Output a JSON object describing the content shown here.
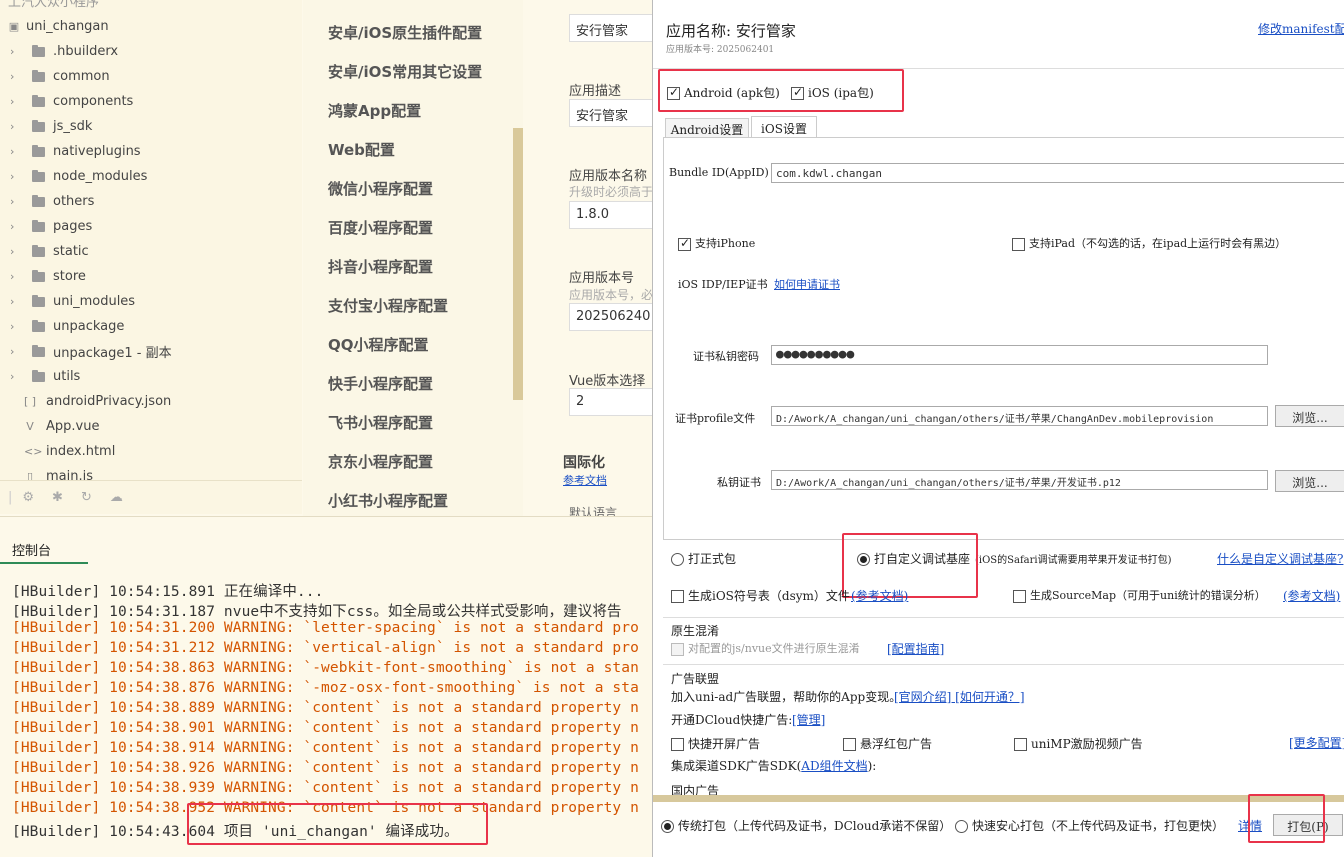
{
  "tree": {
    "header": "上汽大众小程序",
    "project": "uni_changan",
    "items": [
      {
        "label": ".hbuilderx",
        "kind": "folder"
      },
      {
        "label": "common",
        "kind": "folder"
      },
      {
        "label": "components",
        "kind": "folder"
      },
      {
        "label": "js_sdk",
        "kind": "folder"
      },
      {
        "label": "nativeplugins",
        "kind": "folder"
      },
      {
        "label": "node_modules",
        "kind": "folder"
      },
      {
        "label": "others",
        "kind": "folder"
      },
      {
        "label": "pages",
        "kind": "folder"
      },
      {
        "label": "static",
        "kind": "folder"
      },
      {
        "label": "store",
        "kind": "folder"
      },
      {
        "label": "uni_modules",
        "kind": "folder"
      },
      {
        "label": "unpackage",
        "kind": "folder"
      },
      {
        "label": "unpackage1 - 副本",
        "kind": "folder"
      },
      {
        "label": "utils",
        "kind": "folder"
      },
      {
        "label": "androidPrivacy.json",
        "kind": "json"
      },
      {
        "label": "App.vue",
        "kind": "vue"
      },
      {
        "label": "index.html",
        "kind": "html"
      },
      {
        "label": "main.js",
        "kind": "js"
      }
    ]
  },
  "midnav": {
    "items": [
      "安卓/iOS原生插件配置",
      "安卓/iOS常用其它设置",
      "鸿蒙App配置",
      "Web配置",
      "微信小程序配置",
      "百度小程序配置",
      "抖音小程序配置",
      "支付宝小程序配置",
      "QQ小程序配置",
      "快手小程序配置",
      "飞书小程序配置",
      "京东小程序配置",
      "小红书小程序配置"
    ]
  },
  "form": {
    "app_name_value": "安行管家",
    "desc_label": "应用描述",
    "desc_value": "安行管家",
    "vname_label": "应用版本名称",
    "vname_hint": "升级时必须高于",
    "vname_value": "1.8.0",
    "vcode_label": "应用版本号",
    "vcode_hint": "应用版本号，必",
    "vcode_value": "202506240",
    "vue_label": "Vue版本选择",
    "vue_value": "2",
    "i18n_title": "国际化",
    "i18n_link": "参考文档",
    "default_lang": "默认语言"
  },
  "console": {
    "tab": "控制台",
    "lines": [
      {
        "text": "[HBuilder] 10:54:15.891 正在编译中...",
        "level": "normal"
      },
      {
        "text": "[HBuilder] 10:54:31.187 nvue中不支持如下css。如全局或公共样式受影响，建议将告",
        "level": "normal"
      },
      {
        "text": "[HBuilder] 10:54:31.200 WARNING: `letter-spacing` is not a standard pro",
        "level": "warn"
      },
      {
        "text": "[HBuilder] 10:54:31.212 WARNING: `vertical-align` is not a standard pro",
        "level": "warn"
      },
      {
        "text": "[HBuilder] 10:54:38.863 WARNING: `-webkit-font-smoothing` is not a stan",
        "level": "warn"
      },
      {
        "text": "[HBuilder] 10:54:38.876 WARNING: `-moz-osx-font-smoothing` is not a sta",
        "level": "warn"
      },
      {
        "text": "[HBuilder] 10:54:38.889 WARNING: `content` is not a standard property n",
        "level": "warn"
      },
      {
        "text": "[HBuilder] 10:54:38.901 WARNING: `content` is not a standard property n",
        "level": "warn"
      },
      {
        "text": "[HBuilder] 10:54:38.914 WARNING: `content` is not a standard property n",
        "level": "warn"
      },
      {
        "text": "[HBuilder] 10:54:38.926 WARNING: `content` is not a standard property n",
        "level": "warn"
      },
      {
        "text": "[HBuilder] 10:54:38.939 WARNING: `content` is not a standard property n",
        "level": "warn"
      },
      {
        "text": "[HBuilder] 10:54:38.952 WARNING: `content` is not a standard property n",
        "level": "warn"
      },
      {
        "text": "[HBuilder] 10:54:43.604 项目 'uni_changan' 编译成功。",
        "level": "normal"
      }
    ]
  },
  "dialog": {
    "app_name": "应用名称: 安行管家",
    "version_hint": "应用版本号: 2025062401",
    "edit_manifest": "修改manifest配置",
    "android_pkg": "Android (apk包)",
    "ios_pkg": "iOS (ipa包)",
    "tab_android": "Android设置",
    "tab_ios": "iOS设置",
    "bundle_label": "Bundle ID(AppID)",
    "bundle_value": "com.kdwl.changan",
    "support_iphone": "支持iPhone",
    "support_ipad": "支持iPad（不勾选的话，在ipad上运行时会有黑边）",
    "cert_label": "iOS IDP/IEP证书",
    "cert_link": "如何申请证书",
    "pwd_label": "证书私钥密码",
    "pwd_value": "●●●●●●●●●●",
    "profile_label": "证书profile文件",
    "profile_value": "D:/Awork/A_changan/uni_changan/others/证书/苹果/ChangAnDev.mobileprovision",
    "browse": "浏览...",
    "key_label": "私钥证书",
    "key_value": "D:/Awork/A_changan/uni_changan/others/证书/苹果/开发证书.p12",
    "formal_pkg": "打正式包",
    "custom_base": "打自定义调试基座",
    "custom_base_note": "(iOS的Safari调试需要用苹果开发证书打包)",
    "custom_base_link": "什么是自定义调试基座?",
    "dsym": "生成iOS符号表（dsym）文件",
    "dsym_link": "(参考文档)",
    "sourcemap": "生成SourceMap（可用于uni统计的错误分析）",
    "sourcemap_link": "(参考文档)",
    "obf_title": "原生混淆",
    "obf_check": "对配置的js/nvue文件进行原生混淆",
    "obf_link": "[配置指南]",
    "ad_title": "广告联盟",
    "ad_join": "加入uni-ad广告联盟，帮助你的App变现。",
    "ad_links": "[官网介绍] [如何开通？]",
    "ad_open": "开通DCloud快捷广告:",
    "ad_manage": "[管理]",
    "ad_splash": "快捷开屏广告",
    "ad_redpack": "悬浮红包广告",
    "ad_video": "uniMP激励视频广告",
    "ad_more": "[更多配置]",
    "sdk_label": "集成渠道SDK广告SDK(",
    "sdk_link": "AD组件文档",
    "sdk_end": "):",
    "domestic": "国内广告",
    "traditional": "传统打包（上传代码及证书，DCloud承诺不保留）",
    "safe": "快速安心打包（不上传代码及证书，打包更快）",
    "detail": "详情",
    "pack_btn": "打包(P)"
  }
}
